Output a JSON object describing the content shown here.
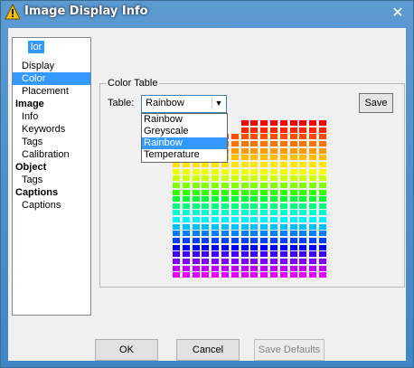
{
  "window": {
    "title": "Image Display Info",
    "close_symbol": "✕"
  },
  "sidebar": {
    "floating_selected": "lor",
    "items": [
      {
        "label": "Display",
        "level": "sub",
        "selected": false
      },
      {
        "label": "Color",
        "level": "sub",
        "selected": true
      },
      {
        "label": "Placement",
        "level": "sub",
        "selected": false
      },
      {
        "label": "Image",
        "level": "head",
        "selected": false
      },
      {
        "label": "Info",
        "level": "sub",
        "selected": false
      },
      {
        "label": "Keywords",
        "level": "sub",
        "selected": false
      },
      {
        "label": "Tags",
        "level": "sub",
        "selected": false
      },
      {
        "label": "Calibration",
        "level": "sub",
        "selected": false
      },
      {
        "label": "Object",
        "level": "head",
        "selected": false
      },
      {
        "label": "Tags",
        "level": "sub",
        "selected": false
      },
      {
        "label": "Captions",
        "level": "head",
        "selected": false
      },
      {
        "label": "Captions",
        "level": "sub",
        "selected": false
      }
    ]
  },
  "color_table": {
    "group_title": "Color Table",
    "table_label": "Table:",
    "combo_value": "Rainbow",
    "save_label": "Save",
    "dropdown_options": [
      "Rainbow",
      "Greyscale",
      "Rainbow",
      "Temperature"
    ],
    "dropdown_highlighted_index": 2,
    "rows_hidden_by_dropdown": 2
  },
  "swatch_colors": [
    "#ff0000",
    "#ff2600",
    "#ff4d00",
    "#ff7300",
    "#ff9900",
    "#ffbf00",
    "#ffe600",
    "#f2ff00",
    "#ccff00",
    "#80ff00",
    "#33ff00",
    "#00ff33",
    "#00ff80",
    "#00ffcc",
    "#00f2ff",
    "#00bfff",
    "#0080ff",
    "#0040ff",
    "#0000ff",
    "#4000ff",
    "#8000ff",
    "#bf00ff",
    "#e600ff"
  ],
  "buttons": {
    "ok": "OK",
    "cancel": "Cancel",
    "save_defaults": "Save Defaults"
  }
}
